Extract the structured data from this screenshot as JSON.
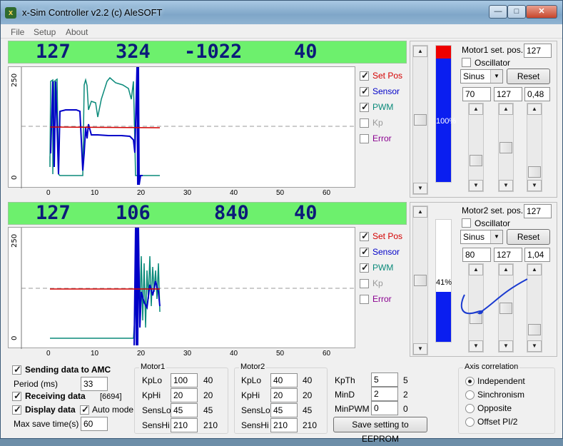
{
  "window": {
    "title": "x-Sim Controller v2.2 (c) AleSOFT",
    "minimize_icon": "minimize-icon",
    "maximize_icon": "maximize-icon",
    "close_icon": "close-icon"
  },
  "menu": [
    "File",
    "Setup",
    "About"
  ],
  "motor1_panel": {
    "readout": [
      "127",
      "324",
      "-1022",
      "40"
    ],
    "graph": {
      "y_ticks": [
        "0",
        "250"
      ],
      "x_ticks": [
        "0",
        "10",
        "20",
        "30",
        "40",
        "50",
        "60"
      ],
      "legend": [
        {
          "label": "Set Pos",
          "checked": true,
          "color": "#d40000"
        },
        {
          "label": "Sensor",
          "checked": true,
          "color": "#0000c8"
        },
        {
          "label": "PWM",
          "checked": true,
          "color": "#0a8a7a"
        },
        {
          "label": "Kp",
          "checked": false,
          "color": "#9a9a9a"
        },
        {
          "label": "Error",
          "checked": false,
          "color": "#8a0090"
        }
      ]
    },
    "gauge_text": "100%",
    "gauge_level": 1.0,
    "set_pos_label": "Motor1 set. pos.",
    "set_pos_value": "127",
    "oscillator_label": "Oscillator",
    "oscillator_checked": false,
    "wave": "Sinus",
    "reset_label": "Reset",
    "params": [
      "70",
      "127",
      "0,48"
    ]
  },
  "motor2_panel": {
    "readout": [
      "127",
      "106",
      "840",
      "40"
    ],
    "graph": {
      "y_ticks": [
        "0",
        "250"
      ],
      "x_ticks": [
        "0",
        "10",
        "20",
        "30",
        "40",
        "50",
        "60"
      ],
      "legend": [
        {
          "label": "Set Pos",
          "checked": true,
          "color": "#d40000"
        },
        {
          "label": "Sensor",
          "checked": true,
          "color": "#0000c8"
        },
        {
          "label": "PWM",
          "checked": true,
          "color": "#0a8a7a"
        },
        {
          "label": "Kp",
          "checked": false,
          "color": "#9a9a9a"
        },
        {
          "label": "Error",
          "checked": false,
          "color": "#8a0090"
        }
      ]
    },
    "gauge_text": "41%",
    "gauge_level": 0.41,
    "set_pos_label": "Motor2 set. pos.",
    "set_pos_value": "127",
    "oscillator_label": "Oscillator",
    "oscillator_checked": false,
    "wave": "Sinus",
    "reset_label": "Reset",
    "params": [
      "80",
      "127",
      "1,04"
    ]
  },
  "bottom": {
    "sending_label": "Sending data to AMC",
    "period_label": "Period (ms)",
    "period_value": "33",
    "receiving_label": "Receiving data",
    "receiving_count": "[6694]",
    "display_label": "Display data",
    "auto_mode_label": "Auto mode",
    "max_save_label": "Max save time(s)",
    "max_save_value": "60",
    "motor1_title": "Motor1",
    "motor2_title": "Motor2",
    "motor1_rows": [
      {
        "label": "KpLo",
        "input": "100",
        "value": "40"
      },
      {
        "label": "KpHi",
        "input": "20",
        "value": "20"
      },
      {
        "label": "SensLo",
        "input": "45",
        "value": "45"
      },
      {
        "label": "SensHi",
        "input": "210",
        "value": "210"
      }
    ],
    "motor2_rows": [
      {
        "label": "KpLo",
        "input": "40",
        "value": "40"
      },
      {
        "label": "KpHi",
        "input": "20",
        "value": "20"
      },
      {
        "label": "SensLo",
        "input": "45",
        "value": "45"
      },
      {
        "label": "SensHi",
        "input": "210",
        "value": "210"
      }
    ],
    "extra_rows": [
      {
        "label": "KpTh",
        "input": "5",
        "value": "5"
      },
      {
        "label": "MinD",
        "input": "2",
        "value": "2"
      },
      {
        "label": "MinPWM",
        "input": "0",
        "value": "0"
      }
    ],
    "eeprom_button": "Save setting to EEPROM",
    "axis_title": "Axis correlation",
    "axis_options": [
      "Independent",
      "Sinchronism",
      "Opposite",
      "Offset PI/2"
    ],
    "axis_selected": 0
  }
}
